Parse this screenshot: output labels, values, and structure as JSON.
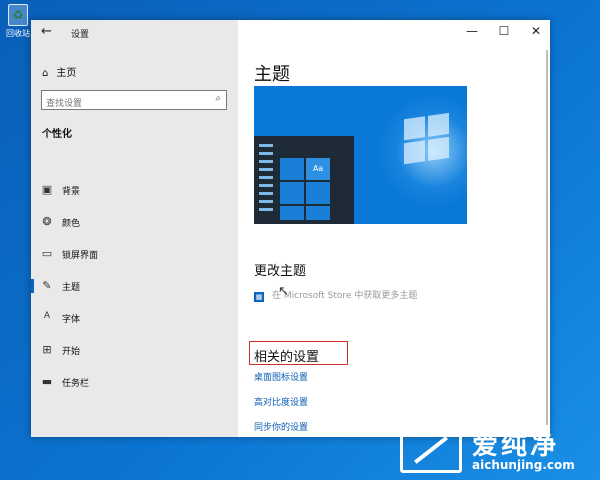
{
  "desktop": {
    "recycle_bin_label": "回收站"
  },
  "window": {
    "title": "设置",
    "back_glyph": "←",
    "minimize_glyph": "—",
    "maximize_glyph": "☐",
    "close_glyph": "✕"
  },
  "sidebar": {
    "home_label": "主页",
    "search_placeholder": "查找设置",
    "section_title": "个性化",
    "items": [
      {
        "label": "背景",
        "icon": "image-icon"
      },
      {
        "label": "颜色",
        "icon": "palette-icon"
      },
      {
        "label": "锁屏界面",
        "icon": "lock-screen-icon"
      },
      {
        "label": "主题",
        "icon": "brush-icon",
        "active": true
      },
      {
        "label": "字体",
        "icon": "font-icon"
      },
      {
        "label": "开始",
        "icon": "start-icon"
      },
      {
        "label": "任务栏",
        "icon": "taskbar-icon"
      }
    ]
  },
  "content": {
    "page_title": "主题",
    "preview_text": "Aa",
    "change_theme_heading": "更改主题",
    "store_link": "在 Microsoft Store 中获取更多主题",
    "related_heading": "相关的设置",
    "links": [
      "桌面图标设置",
      "高对比度设置",
      "同步你的设置"
    ]
  },
  "watermark": {
    "cn": "爱纯净",
    "en": "aichunjing.com"
  },
  "colors": {
    "accent": "#0b64c0",
    "desktop": "#0b74d1",
    "highlight_box": "#d0302a"
  }
}
